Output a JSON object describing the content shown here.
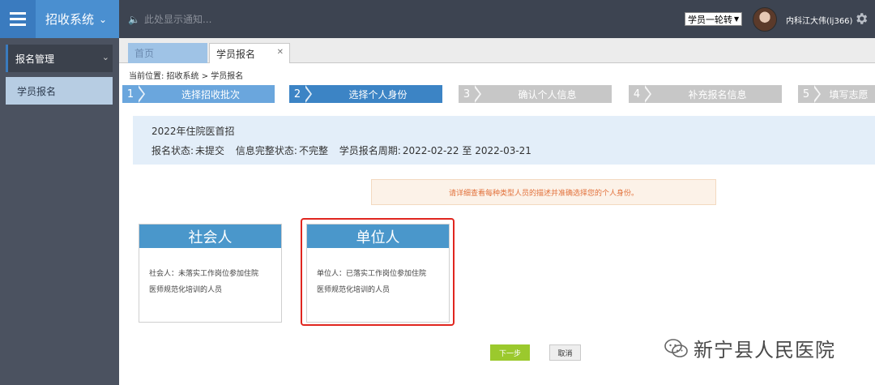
{
  "header": {
    "app_title": "招收系统",
    "notice": "此处显示通知...",
    "role_select": "学员一轮转",
    "username": "内科江大伟(lj366)"
  },
  "sidebar": {
    "group_label": "报名管理",
    "items": [
      {
        "label": "学员报名"
      }
    ]
  },
  "tabs": [
    {
      "label": "首页"
    },
    {
      "label": "学员报名"
    }
  ],
  "breadcrumb": "当前位置:  招收系统 > 学员报名",
  "steps": [
    {
      "num": "1",
      "label": "选择招收批次"
    },
    {
      "num": "2",
      "label": "选择个人身份"
    },
    {
      "num": "3",
      "label": "确认个人信息"
    },
    {
      "num": "4",
      "label": "补充报名信息"
    },
    {
      "num": "5",
      "label": "填写志愿"
    }
  ],
  "info": {
    "title": "2022年住院医首招",
    "status_label": "报名状态:",
    "status_value": "未提交",
    "completeness_label": "信息完整状态:",
    "completeness_value": "不完整",
    "period_label": "学员报名周期:",
    "period_value": "2022-02-22 至 2022-03-21"
  },
  "hint": "请详细查看每种类型人员的描述并准确选择您的个人身份。",
  "cards": [
    {
      "title": "社会人",
      "desc_line1": "社会人：未落实工作岗位参加住院",
      "desc_line2": "医师规范化培训的人员"
    },
    {
      "title": "单位人",
      "desc_line1": "单位人：已落实工作岗位参加住院",
      "desc_line2": "医师规范化培训的人员"
    }
  ],
  "buttons": {
    "next": "下一步",
    "cancel": "取消"
  },
  "watermark": "新宁县人民医院",
  "colors": {
    "topbar": "#3d4451",
    "sidebar": "#4b5260",
    "accent": "#3c84c5",
    "card_header": "#4a97cb",
    "next_button": "#9bc92d",
    "highlight": "#e0261f"
  }
}
